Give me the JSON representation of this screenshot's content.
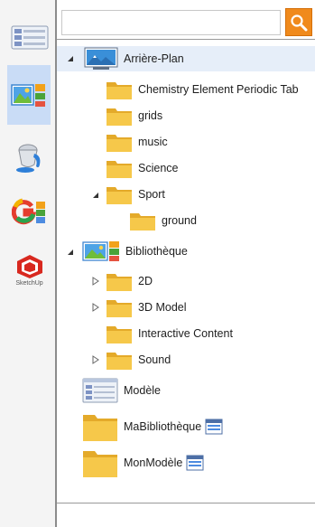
{
  "search": {
    "value": "",
    "placeholder": ""
  },
  "tree": {
    "arriere_plan": {
      "label": "Arrière-Plan",
      "children": [
        "Chemistry Element Periodic Tab",
        "grids",
        "music",
        "Science",
        "Sport"
      ],
      "sport_children": [
        "ground"
      ]
    },
    "bibliotheque": {
      "label": "Bibliothèque",
      "children": [
        "2D",
        "3D Model",
        "Interactive Content",
        "Sound"
      ]
    },
    "modele": {
      "label": "Modèle"
    },
    "ma_bibliotheque": {
      "label": "MaBibliothèque"
    },
    "mon_modele": {
      "label": "MonModèle"
    }
  },
  "sidebar": {
    "items": [
      {
        "name": "templates",
        "icon": "list-view-icon"
      },
      {
        "name": "media-library",
        "icon": "image-library-icon"
      },
      {
        "name": "fill",
        "icon": "paint-bucket-icon"
      },
      {
        "name": "google-images",
        "icon": "google-images-icon"
      },
      {
        "name": "sketchup",
        "icon": "sketchup-icon",
        "caption": "SketchUp"
      }
    ]
  },
  "colors": {
    "accent_orange": "#f08a1c",
    "folder_yellow": "#f6c84a",
    "selected_blue": "#c9dcf6"
  }
}
